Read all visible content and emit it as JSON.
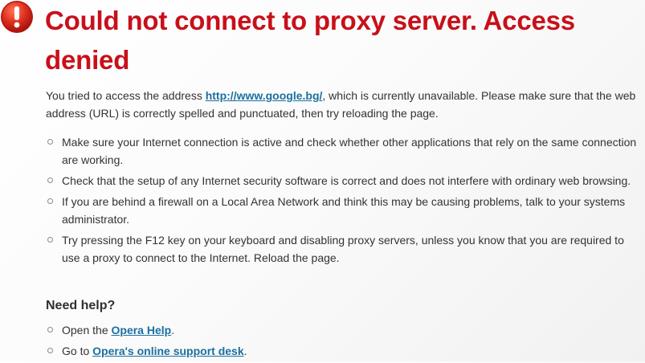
{
  "error": {
    "icon": "exclamation-circle-icon",
    "title": "Could not connect to proxy server. Access denied",
    "intro_before": "You tried to access the address ",
    "url": "http://www.google.bg/",
    "intro_after": ", which is currently unavailable. Please make sure that the web address (URL) is correctly spelled and punctuated, then try reloading the page."
  },
  "tips": [
    "Make sure your Internet connection is active and check whether other applications that rely on the same connection are working.",
    "Check that the setup of any Internet security software is correct and does not interfere with ordinary web browsing.",
    "If you are behind a firewall on a Local Area Network and think this may be causing problems, talk to your systems administrator.",
    "Try pressing the F12 key on your keyboard and disabling proxy servers, unless you know that you are required to use a proxy to connect to the Internet. Reload the page."
  ],
  "help": {
    "heading": "Need help?",
    "items": [
      {
        "prefix": "Open the ",
        "link": "Opera Help",
        "suffix": "."
      },
      {
        "prefix": "Go to ",
        "link": "Opera's online support desk",
        "suffix": "."
      }
    ]
  },
  "colors": {
    "title": "#c8101a",
    "link": "#1b6fa1",
    "icon": "#d8251b"
  }
}
